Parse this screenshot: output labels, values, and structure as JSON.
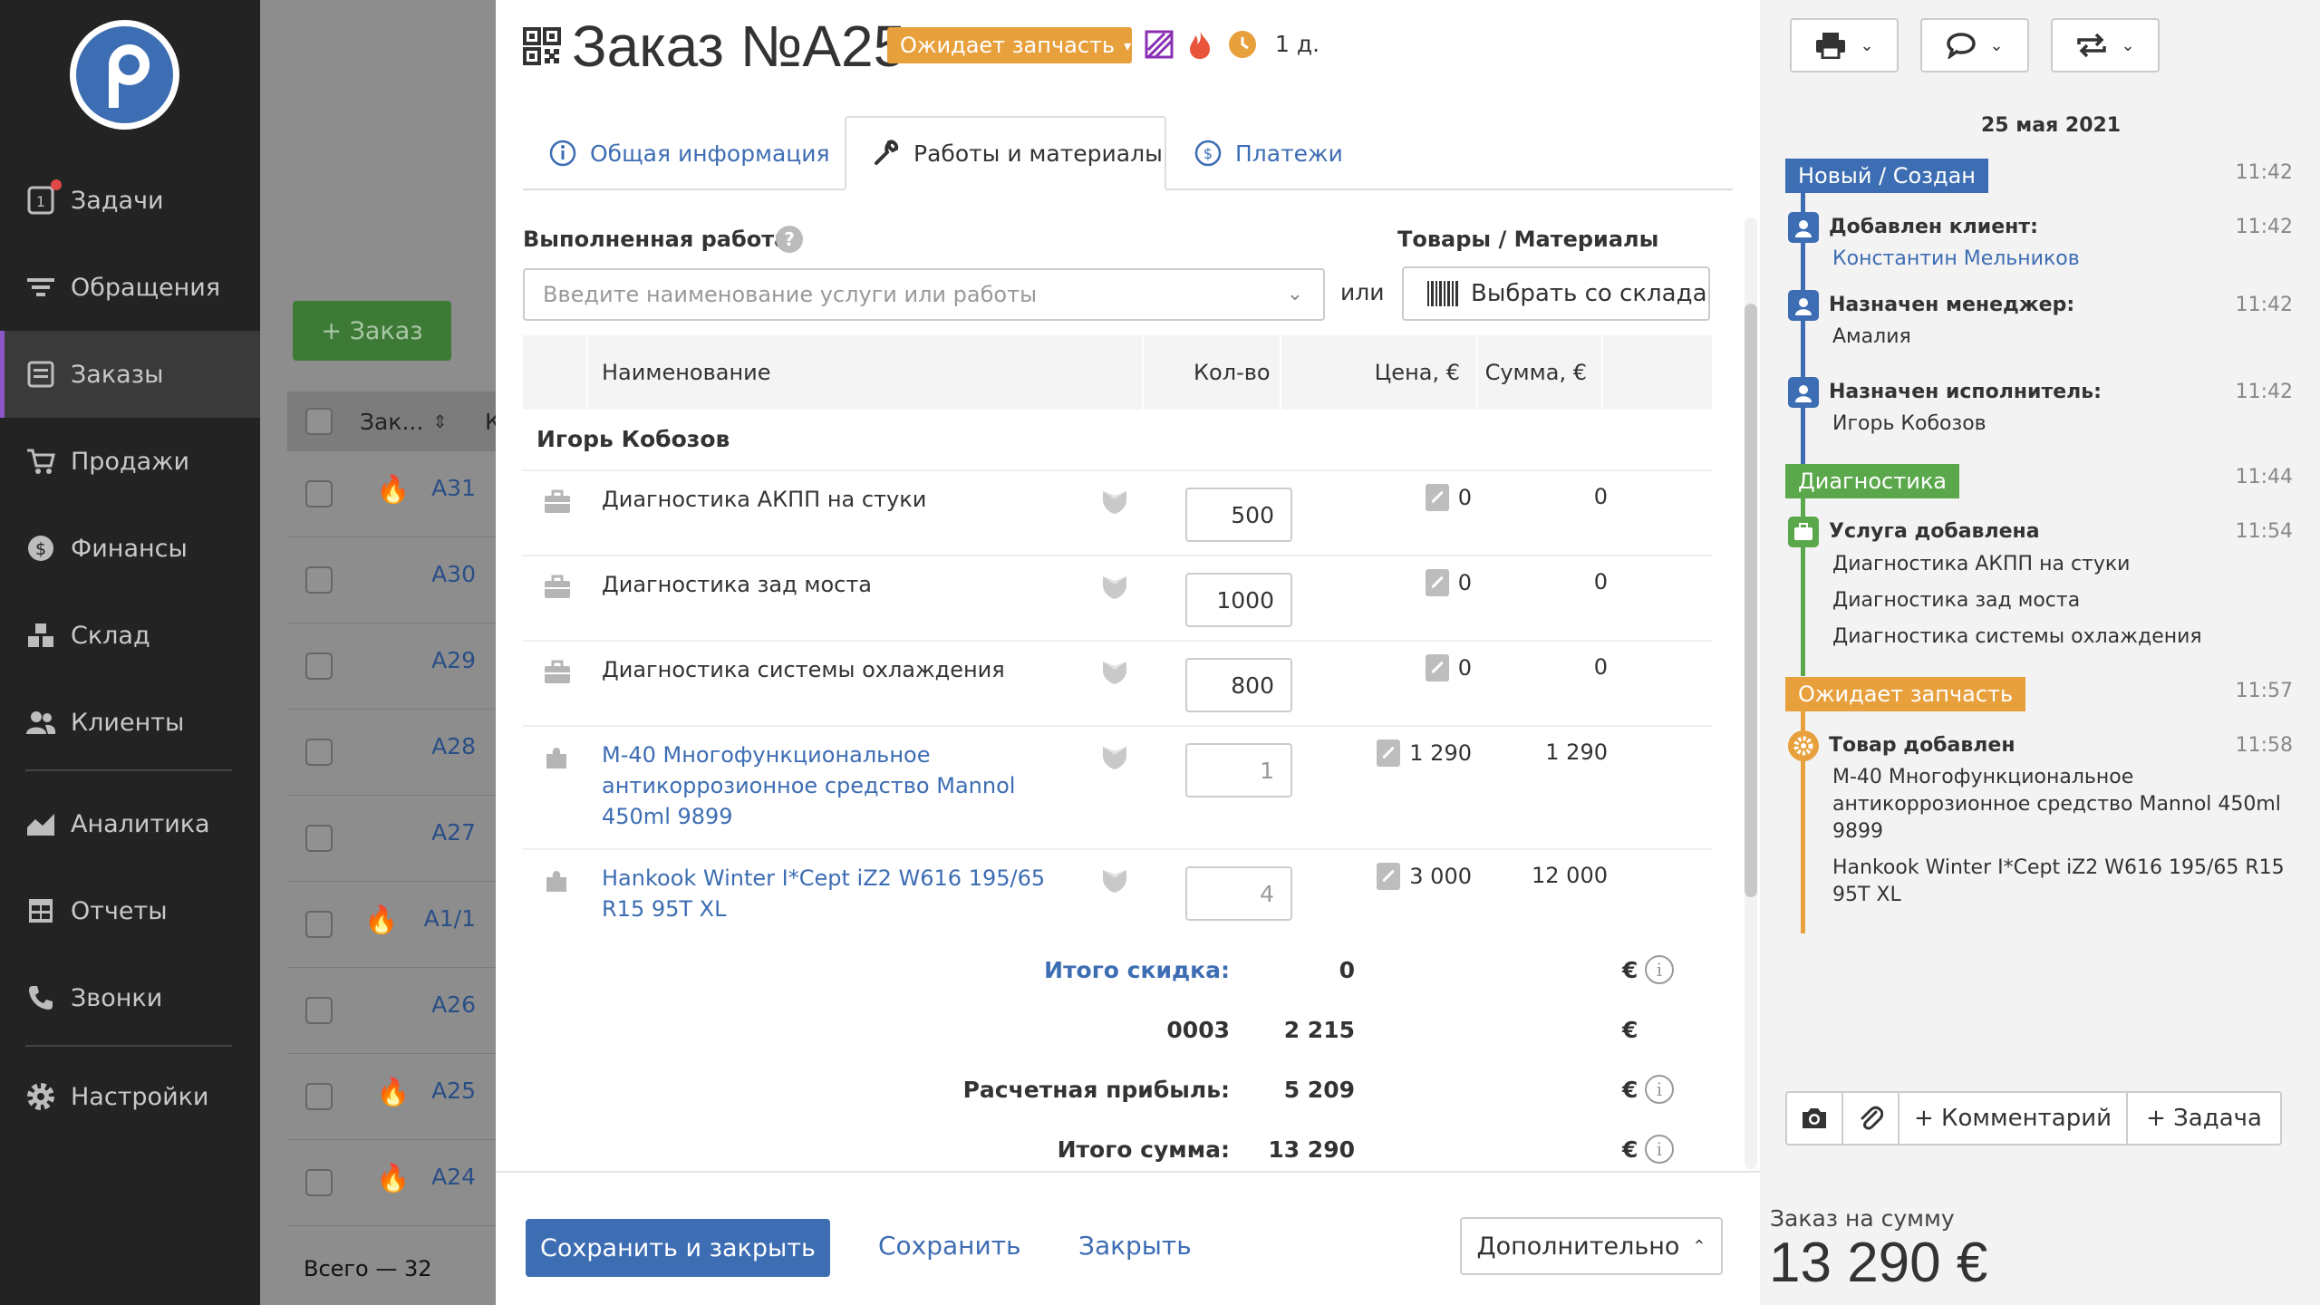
{
  "sidebar": {
    "items": [
      {
        "label": "Задачи",
        "icon": "tasks-icon"
      },
      {
        "label": "Обращения",
        "icon": "filter-icon"
      },
      {
        "label": "Заказы",
        "icon": "orders-icon",
        "active": true
      },
      {
        "label": "Продажи",
        "icon": "cart-icon"
      },
      {
        "label": "Финансы",
        "icon": "dollar-icon"
      },
      {
        "label": "Склад",
        "icon": "warehouse-icon"
      },
      {
        "label": "Клиенты",
        "icon": "users-icon"
      },
      {
        "label": "Аналитика",
        "icon": "chart-icon"
      },
      {
        "label": "Отчеты",
        "icon": "table-icon"
      },
      {
        "label": "Звонки",
        "icon": "phone-icon"
      },
      {
        "label": "Настройки",
        "icon": "gear-icon"
      }
    ]
  },
  "background_list": {
    "add_button": "+ Заказ",
    "header_col": "Зак...",
    "header_col2": "К",
    "rows": [
      {
        "num": "A31",
        "fire": true
      },
      {
        "num": "A30",
        "fire": false
      },
      {
        "num": "A29",
        "fire": false
      },
      {
        "num": "A28",
        "fire": false
      },
      {
        "num": "A27",
        "fire": false
      },
      {
        "num": "A1/1",
        "fire": true
      },
      {
        "num": "A26",
        "fire": false
      },
      {
        "num": "A25",
        "fire": true
      },
      {
        "num": "A24",
        "fire": true
      }
    ],
    "total": "Всего — 32"
  },
  "order": {
    "title": "Заказ №A25",
    "status": "Ожидает запчасть",
    "days": "1 д.",
    "colors": {
      "status": "#e8a03c",
      "accent": "#3d6db3",
      "diag": "#5aa84b",
      "new": "#3d6db3"
    }
  },
  "tabs": [
    {
      "label": "Общая информация",
      "icon": "info-icon"
    },
    {
      "label": "Работы и материалы",
      "icon": "wrench-icon",
      "active": true
    },
    {
      "label": "Платежи",
      "icon": "dollar-circle-icon"
    }
  ],
  "works": {
    "label": "Выполненная работа",
    "input_placeholder": "Введите наименование услуги или работы",
    "or": "или",
    "goods_label": "Товары / Материалы",
    "stock_button": "Выбрать со склада"
  },
  "table": {
    "headers": {
      "name": "Наименование",
      "qty": "Кол-во",
      "price": "Цена, €",
      "sum": "Сумма, €"
    },
    "group": "Игорь Кобозов",
    "rows": [
      {
        "name": "Диагностика АКПП на стуки",
        "qty": "500",
        "price": "0",
        "sum": "0",
        "type": "service"
      },
      {
        "name": "Диагностика зад моста",
        "qty": "1000",
        "price": "0",
        "sum": "0",
        "type": "service"
      },
      {
        "name": "Диагностика системы охлаждения",
        "qty": "800",
        "price": "0",
        "sum": "0",
        "type": "service"
      },
      {
        "name": "M-40 Многофункциональное антикоррозионное средство Mannol 450ml 9899",
        "qty": "1",
        "price": "1 290",
        "sum": "1 290",
        "type": "product"
      },
      {
        "name": "Hankook Winter I*Cept iZ2 W616 195/65 R15 95T XL",
        "qty": "4",
        "price": "3 000",
        "sum": "12 000",
        "type": "product"
      }
    ]
  },
  "totals": {
    "discount_label": "Итого скидка:",
    "discount_value": "0",
    "code_label": "0003",
    "code_value": "2 215",
    "profit_label": "Расчетная прибыль:",
    "profit_value": "5 209",
    "total_label": "Итого сумма:",
    "total_value": "13 290",
    "currency": "€"
  },
  "footer": {
    "save_close": "Сохранить и закрыть",
    "save": "Сохранить",
    "close": "Закрыть",
    "more": "Дополнительно"
  },
  "history": {
    "date": "25 мая 2021",
    "statuses": {
      "new": {
        "label": "Новый / Создан",
        "time": "11:42"
      },
      "diag": {
        "label": "Диагностика",
        "time": "11:44"
      },
      "waiting": {
        "label": "Ожидает запчасть",
        "time": "11:57"
      }
    },
    "events": [
      {
        "title": "Добавлен клиент:",
        "text": "Константин Мельников",
        "time": "11:42"
      },
      {
        "title": "Назначен менеджер:",
        "text": "Амалия",
        "time": "11:42"
      },
      {
        "title": "Назначен исполнитель:",
        "text": "Игорь Кобозов",
        "time": "11:42"
      },
      {
        "title": "Услуга добавлена",
        "lines": [
          "Диагностика АКПП на стуки",
          "Диагностика зад моста",
          "Диагностика системы охлаждения"
        ],
        "time": "11:54"
      },
      {
        "title": "Товар добавлен",
        "lines": [
          "M-40 Многофункциональное антикоррозионное средство Mannol 450ml 9899",
          "Hankook Winter I*Cept iZ2 W616 195/65 R15 95T XL"
        ],
        "time": "11:58"
      }
    ],
    "comment_button": "+ Комментарий",
    "task_button": "+ Задача"
  },
  "summary": {
    "label": "Заказ на сумму",
    "value": "13 290 €"
  }
}
